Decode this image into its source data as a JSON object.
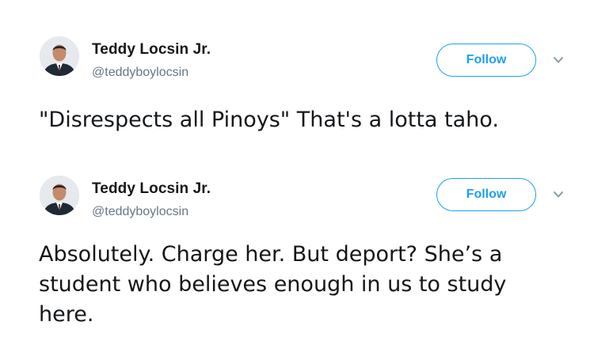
{
  "tweets": [
    {
      "display_name": "Teddy Locsin Jr.",
      "handle": "@teddyboylocsin",
      "follow_label": "Follow",
      "text": "\"Disrespects all Pinoys\" That's a lotta taho."
    },
    {
      "display_name": "Teddy Locsin Jr.",
      "handle": "@teddyboylocsin",
      "follow_label": "Follow",
      "text": "Absolutely. Charge her. But deport? She’s a student who believes enough in us to study here."
    }
  ],
  "icons": {
    "avatar": "user-avatar-photo",
    "menu_caret": "chevron-down-icon"
  },
  "colors": {
    "accent": "#1da1f2",
    "name": "#14171a",
    "handle": "#657786"
  }
}
